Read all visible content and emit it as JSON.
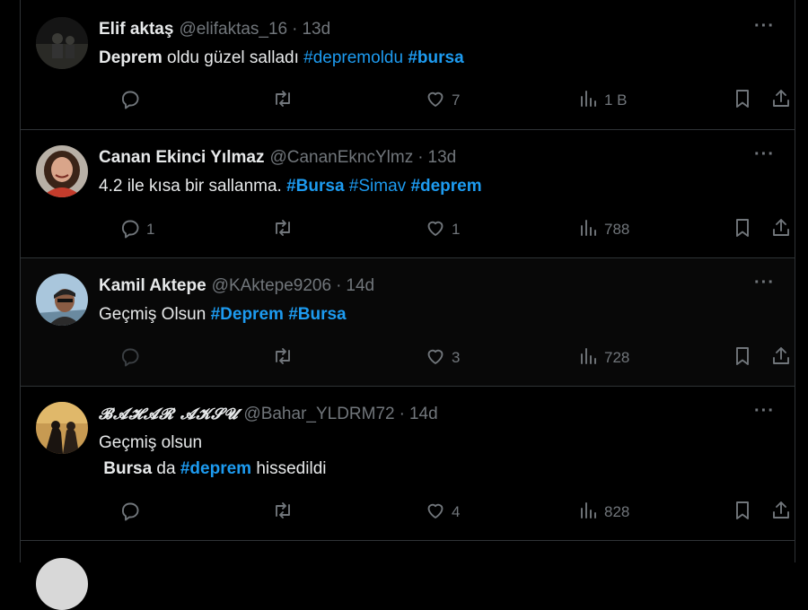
{
  "tweets": [
    {
      "name": "Elif aktaş",
      "handle": "@elifaktas_16",
      "time": "13d",
      "text_parts": [
        {
          "t": "Deprem",
          "style": "b"
        },
        {
          "t": " oldu güzel salladı ",
          "style": ""
        },
        {
          "t": "#depremoldu",
          "style": "tag"
        },
        {
          "t": " ",
          "style": ""
        },
        {
          "t": "#bursa",
          "style": "tagb"
        }
      ],
      "replies": "",
      "retweets": "",
      "likes": "7",
      "views": "1 B"
    },
    {
      "name": "Canan Ekinci Yılmaz",
      "handle": "@CananEkncYlmz",
      "time": "13d",
      "text_parts": [
        {
          "t": "4.2 ile kısa bir sallanma. ",
          "style": ""
        },
        {
          "t": "#Bursa",
          "style": "tagb"
        },
        {
          "t": " ",
          "style": ""
        },
        {
          "t": "#Simav",
          "style": "tag"
        },
        {
          "t": " ",
          "style": ""
        },
        {
          "t": "#deprem",
          "style": "tagb"
        }
      ],
      "replies": "1",
      "retweets": "",
      "likes": "1",
      "views": "788"
    },
    {
      "name": "Kamil Aktepe",
      "handle": "@KAktepe9206",
      "time": "14d",
      "text_parts": [
        {
          "t": "Geçmiş Olsun ",
          "style": ""
        },
        {
          "t": "#Deprem",
          "style": "tagb"
        },
        {
          "t": " ",
          "style": ""
        },
        {
          "t": "#Bursa",
          "style": "tagb"
        }
      ],
      "replies": "",
      "retweets": "",
      "likes": "3",
      "views": "728"
    },
    {
      "name": "𝓑𝓐𝓗𝓐𝓡 𝓐𝓚𝓢𝓤",
      "handle": "@Bahar_YLDRM72",
      "time": "14d",
      "text_parts": [
        {
          "t": "Geçmiş olsun\n ",
          "style": ""
        },
        {
          "t": "Bursa",
          "style": "b"
        },
        {
          "t": " da ",
          "style": ""
        },
        {
          "t": "#deprem",
          "style": "tagb"
        },
        {
          "t": " hissedildi",
          "style": ""
        }
      ],
      "replies": "",
      "retweets": "",
      "likes": "4",
      "views": "828"
    }
  ],
  "icons": {
    "more": "more-dots-icon",
    "reply": "reply-icon",
    "retweet": "retweet-icon",
    "like": "heart-icon",
    "views": "views-chart-icon",
    "bookmark": "bookmark-icon",
    "share": "share-icon"
  },
  "colors": {
    "background": "#000000",
    "text": "#e7e9ea",
    "muted": "#71767b",
    "link": "#1d9bf0",
    "border": "#2f3336"
  }
}
